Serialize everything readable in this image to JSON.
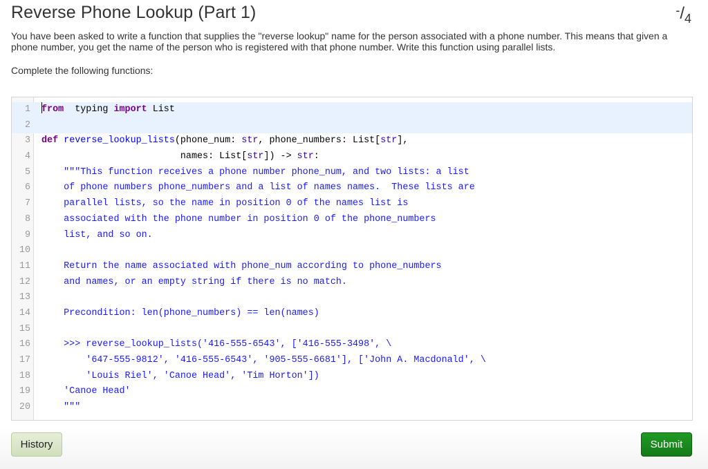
{
  "page": {
    "title": "Reverse Phone Lookup (Part 1)",
    "score": {
      "earned": "-",
      "total": "4"
    },
    "description": "You have been asked to write a function that supplies the \"reverse lookup\" name for the person associated with a phone number. This means that given a phone number, you get the name of the person who is registered with that phone number. Write this function using parallel lists.",
    "instructions": "Complete the following functions:"
  },
  "editor": {
    "active_lines": [
      1,
      2
    ],
    "lines": [
      {
        "n": "1",
        "tokens": [
          [
            "kw",
            "from"
          ],
          [
            "",
            "  typing "
          ],
          [
            "kw",
            "import"
          ],
          [
            "",
            " List"
          ]
        ]
      },
      {
        "n": "2",
        "tokens": []
      },
      {
        "n": "3",
        "tokens": [
          [
            "def-kw",
            "def"
          ],
          [
            "",
            " "
          ],
          [
            "fn",
            "reverse_lookup_lists"
          ],
          [
            "",
            "(phone_num: "
          ],
          [
            "builtin",
            "str"
          ],
          [
            "",
            ", phone_numbers: List["
          ],
          [
            "builtin",
            "str"
          ],
          [
            "",
            "],"
          ]
        ]
      },
      {
        "n": "4",
        "tokens": [
          [
            "",
            "                         names: List["
          ],
          [
            "builtin",
            "str"
          ],
          [
            "",
            "]) -> "
          ],
          [
            "builtin",
            "str"
          ],
          [
            "",
            ":"
          ]
        ]
      },
      {
        "n": "5",
        "tokens": [
          [
            "doc",
            "    \"\"\"This function receives a phone number phone_num, and two lists: a list"
          ]
        ]
      },
      {
        "n": "6",
        "tokens": [
          [
            "doc",
            "    of phone numbers phone_numbers and a list of names names.  These lists are"
          ]
        ]
      },
      {
        "n": "7",
        "tokens": [
          [
            "doc",
            "    parallel lists, so the name in position 0 of the names list is"
          ]
        ]
      },
      {
        "n": "8",
        "tokens": [
          [
            "doc",
            "    associated with the phone number in position 0 of the phone_numbers"
          ]
        ]
      },
      {
        "n": "9",
        "tokens": [
          [
            "doc",
            "    list, and so on."
          ]
        ]
      },
      {
        "n": "10",
        "tokens": []
      },
      {
        "n": "11",
        "tokens": [
          [
            "doc",
            "    Return the name associated with phone_num according to phone_numbers"
          ]
        ]
      },
      {
        "n": "12",
        "tokens": [
          [
            "doc",
            "    and names, or an empty string if there is no match."
          ]
        ]
      },
      {
        "n": "13",
        "tokens": []
      },
      {
        "n": "14",
        "tokens": [
          [
            "doc",
            "    Precondition: len(phone_numbers) == len(names)"
          ]
        ]
      },
      {
        "n": "15",
        "tokens": []
      },
      {
        "n": "16",
        "tokens": [
          [
            "doc",
            "    >>> reverse_lookup_lists('416-555-6543', ['416-555-3498', \\"
          ]
        ]
      },
      {
        "n": "17",
        "tokens": [
          [
            "doc",
            "        '647-555-9812', '416-555-6543', '905-555-6681'], ['John A. Macdonald', \\"
          ]
        ]
      },
      {
        "n": "18",
        "tokens": [
          [
            "doc",
            "        'Louis Riel', 'Canoe Head', 'Tim Horton'])"
          ]
        ]
      },
      {
        "n": "19",
        "tokens": [
          [
            "doc",
            "    'Canoe Head'"
          ]
        ]
      },
      {
        "n": "20",
        "tokens": [
          [
            "doc",
            "    \"\"\""
          ]
        ]
      }
    ]
  },
  "buttons": {
    "history": "History",
    "submit": "Submit"
  }
}
